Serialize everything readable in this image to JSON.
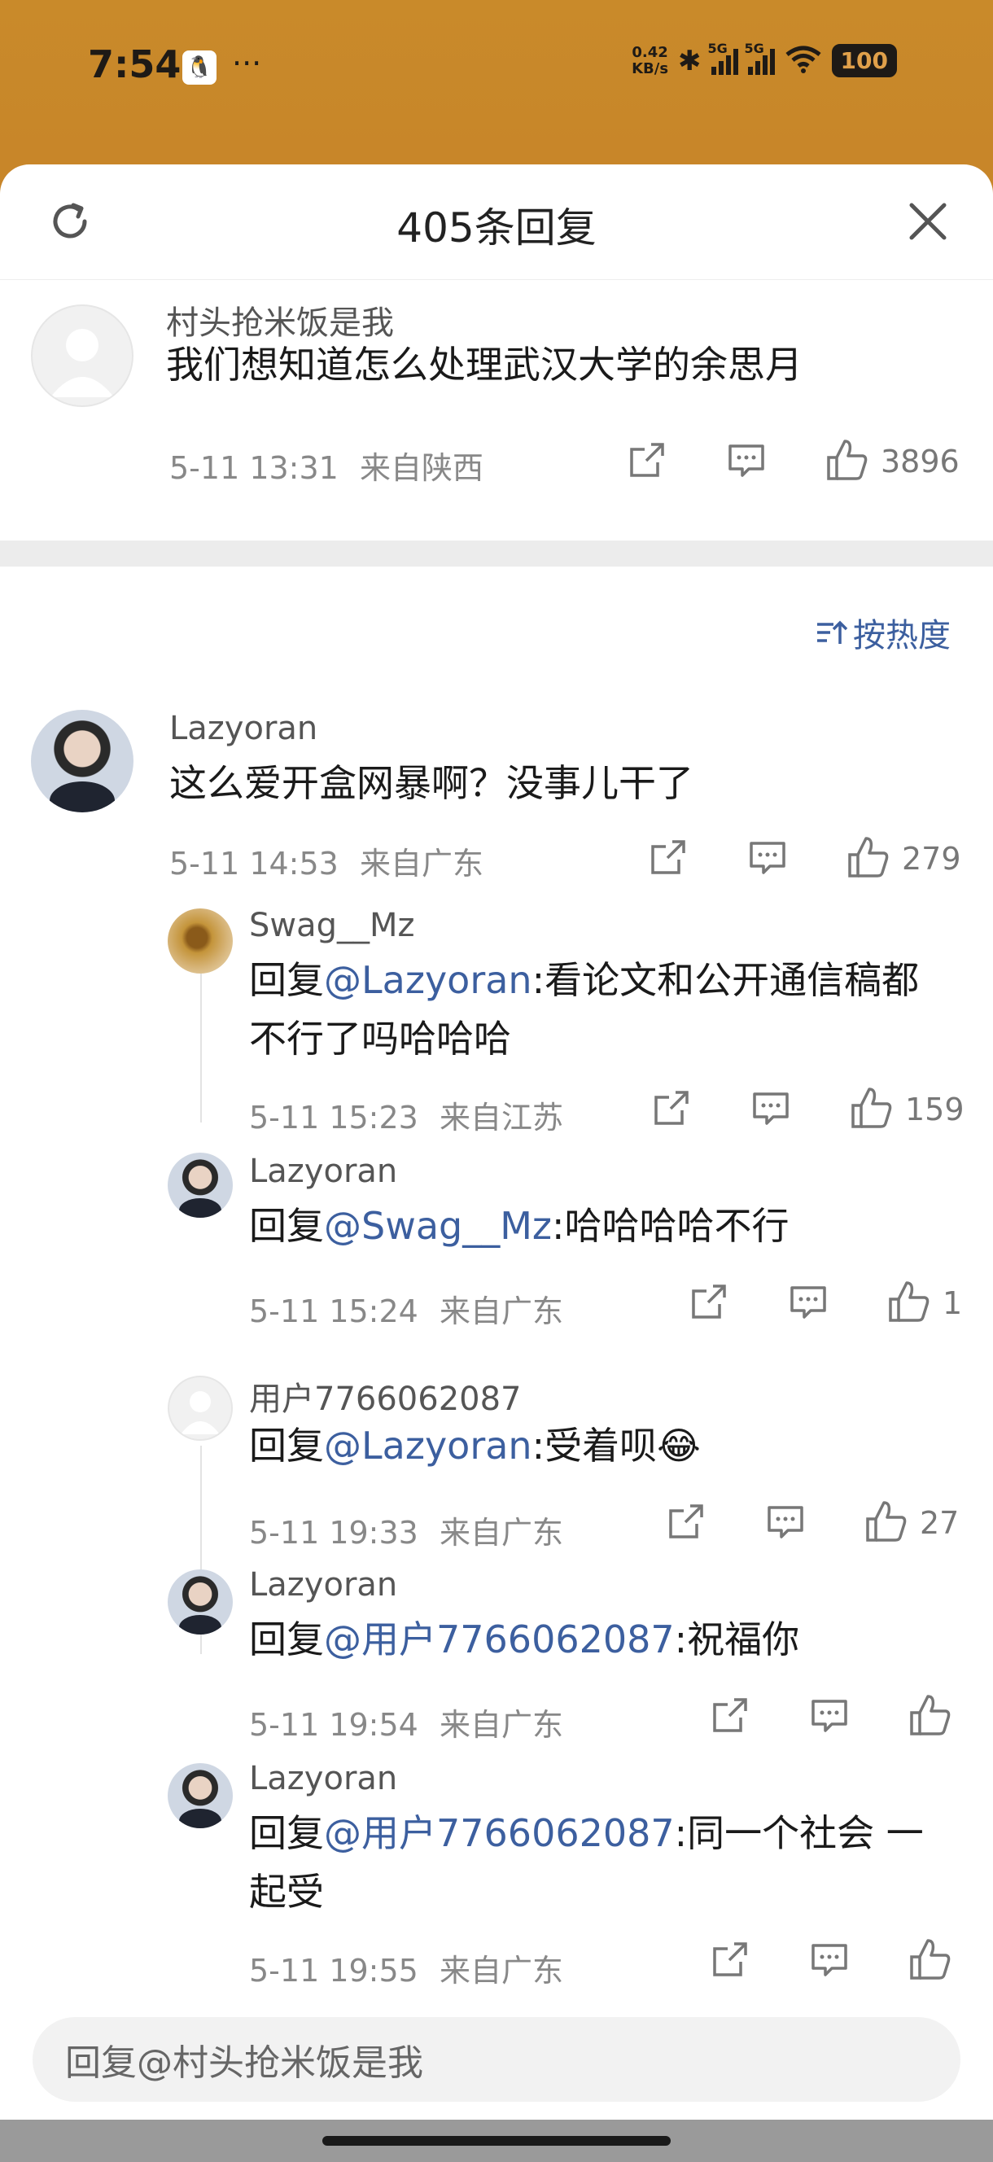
{
  "status_bar": {
    "time": "7:54",
    "net_speed_value": "0.42",
    "net_speed_unit": "KB/s",
    "signal_tag": "5G",
    "battery": "100"
  },
  "sheet": {
    "title": "405条回复"
  },
  "main_comment": {
    "author": "村头抢米饭是我",
    "text": "我们想知道怎么处理武汉大学的余思月",
    "time": "5-11 13:31",
    "location": "来自陕西",
    "likes": "3896"
  },
  "sort": {
    "label": "按热度"
  },
  "replies": [
    {
      "author": "Lazyoran",
      "prefix": "",
      "mention": "",
      "text": "这么爱开盒网暴啊？没事儿干了",
      "time": "5-11 14:53",
      "location": "来自广东",
      "likes": "279"
    },
    {
      "author": "Swag__Mz",
      "prefix": "回复",
      "mention": "@Lazyoran",
      "text": ":看论文和公开通信稿都",
      "text2": "不行了吗哈哈哈",
      "time": "5-11 15:23",
      "location": "来自江苏",
      "likes": "159"
    },
    {
      "author": "Lazyoran",
      "prefix": "回复",
      "mention": "@Swag__Mz",
      "text": ":哈哈哈哈不行",
      "time": "5-11 15:24",
      "location": "来自广东",
      "likes": "1"
    },
    {
      "author": "用户7766062087",
      "prefix": "回复",
      "mention": "@Lazyoran",
      "text": ":受着呗😂",
      "time": "5-11 19:33",
      "location": "来自广东",
      "likes": "27"
    },
    {
      "author": "Lazyoran",
      "prefix": "回复",
      "mention": "@用户7766062087",
      "text": ":祝福你",
      "time": "5-11 19:54",
      "location": "来自广东",
      "likes": ""
    },
    {
      "author": "Lazyoran",
      "prefix": "回复",
      "mention": "@用户7766062087",
      "text": ":同一个社会 一",
      "text2": "起受",
      "time": "5-11 19:55",
      "location": "来自广东",
      "likes": ""
    }
  ],
  "reply_input": {
    "placeholder": "回复@村头抢米饭是我"
  }
}
